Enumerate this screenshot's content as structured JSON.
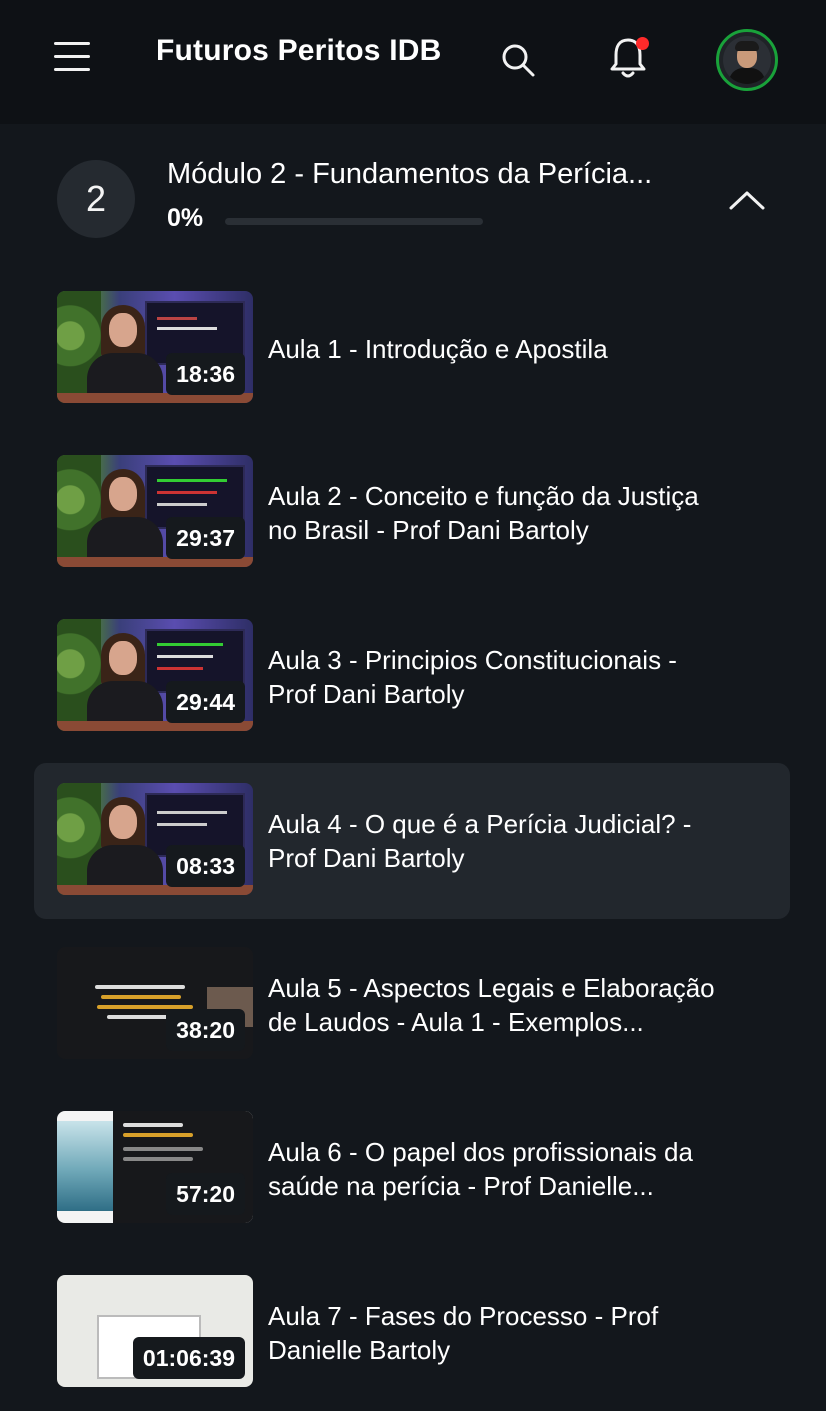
{
  "header": {
    "title": "Futuros Peritos IDB",
    "notification_dot_color": "#ff2a2a",
    "avatar_ring_color": "#19a23a"
  },
  "module": {
    "number": "2",
    "title": "Módulo 2 - Fundamentos da Perícia...",
    "progress_label": "0%",
    "progress": 0,
    "expanded": true
  },
  "lessons": [
    {
      "title_line1": "Aula 1 - Introdução e Apostila",
      "title_line2": "",
      "duration": "18:36",
      "thumb": "studio",
      "active": false
    },
    {
      "title_line1": "Aula 2 - Conceito e função da Justiça",
      "title_line2": "no Brasil - Prof Dani Bartoly",
      "duration": "29:37",
      "thumb": "studio",
      "active": false
    },
    {
      "title_line1": "Aula 3 - Principios Constitucionais -",
      "title_line2": "Prof Dani Bartoly",
      "duration": "29:44",
      "thumb": "studio",
      "active": false
    },
    {
      "title_line1": "Aula 4 - O que é a Perícia Judicial? -",
      "title_line2": "Prof Dani Bartoly",
      "duration": "08:33",
      "thumb": "studio",
      "active": true
    },
    {
      "title_line1": "Aula 5 - Aspectos Legais e Elaboração",
      "title_line2": "de Laudos - Aula 1 - Exemplos...",
      "duration": "38:20",
      "thumb": "dark",
      "active": false
    },
    {
      "title_line1": "Aula 6 - O papel dos profissionais da",
      "title_line2": "saúde na perícia - Prof Danielle...",
      "duration": "57:20",
      "thumb": "med",
      "active": false
    },
    {
      "title_line1": "Aula 7 - Fases do Processo - Prof",
      "title_line2": "Danielle Bartoly",
      "duration": "01:06:39",
      "thumb": "light",
      "active": false
    }
  ],
  "icons": {
    "menu": "hamburger-menu-icon",
    "search": "search-icon",
    "notifications": "bell-icon",
    "collapse": "chevron-up-icon"
  }
}
